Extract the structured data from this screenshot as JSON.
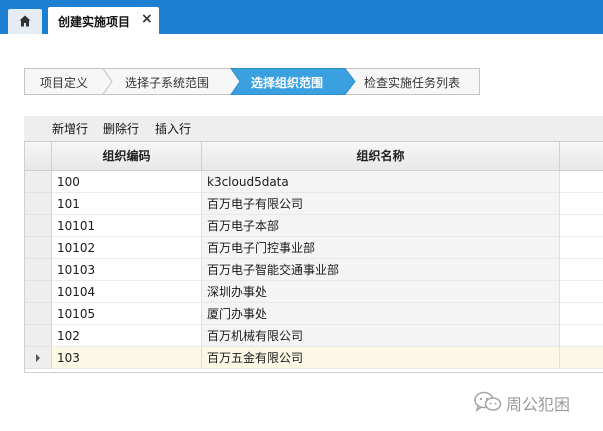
{
  "header": {
    "active_tab": {
      "title": "创建实施项目",
      "close_glyph": "×"
    }
  },
  "wizard": {
    "steps": [
      {
        "label": "项目定义",
        "state": "done"
      },
      {
        "label": "选择子系统范围",
        "state": "done"
      },
      {
        "label": "选择组织范围",
        "state": "active"
      },
      {
        "label": "检查实施任务列表",
        "state": "pending"
      }
    ],
    "active_color": "#3aa0df"
  },
  "toolbar": {
    "add_row": "新增行",
    "delete_row": "删除行",
    "insert_row": "插入行"
  },
  "grid": {
    "columns": [
      "组织编码",
      "组织名称"
    ],
    "rows": [
      {
        "code": "100",
        "name": "k3cloud5data"
      },
      {
        "code": "101",
        "name": "百万电子有限公司"
      },
      {
        "code": "10101",
        "name": "百万电子本部"
      },
      {
        "code": "10102",
        "name": "百万电子门控事业部"
      },
      {
        "code": "10103",
        "name": "百万电子智能交通事业部"
      },
      {
        "code": "10104",
        "name": "深圳办事处"
      },
      {
        "code": "10105",
        "name": "厦门办事处"
      },
      {
        "code": "102",
        "name": "百万机械有限公司"
      },
      {
        "code": "103",
        "name": "百万五金有限公司"
      }
    ],
    "current_row_index": 8
  },
  "watermark": {
    "text": "周公犯困"
  },
  "colors": {
    "topbar": "#1d7fd1",
    "wizard_active": "#3aa0df",
    "current_row": "#fcf8e6"
  }
}
